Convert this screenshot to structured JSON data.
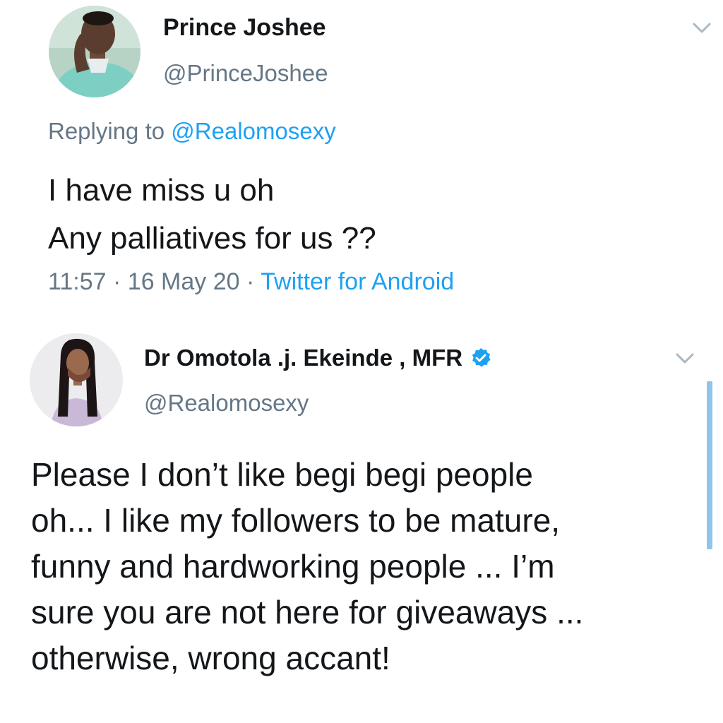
{
  "tweet1": {
    "display_name": "Prince Joshee",
    "handle": "@PrinceJoshee",
    "avatar_icon": "user-avatar-photo",
    "replying_prefix": "Replying to",
    "replying_handle": "@Realomosexy",
    "lines": [
      "I have miss u oh",
      "Any palliatives for us ??"
    ],
    "time": "11:57",
    "date": "16 May 20",
    "separator": " · ",
    "source": "Twitter for Android"
  },
  "tweet2": {
    "display_name": "Dr Omotola .j. Ekeinde , MFR",
    "handle": "@Realomosexy",
    "avatar_icon": "user-avatar-photo",
    "verified_icon": "verified-badge-icon",
    "lines": [
      "Please I don’t like begi begi people",
      "oh... I like my followers to be mature,",
      "funny and hardworking people ... I’m",
      "sure you are not here for giveaways ...",
      "otherwise, wrong accant!"
    ]
  },
  "colors": {
    "text": "#14171a",
    "secondary": "#657786",
    "link": "#1da1f2",
    "verified": "#1da1f2",
    "scroll_indicator": "#8ec5ec"
  }
}
